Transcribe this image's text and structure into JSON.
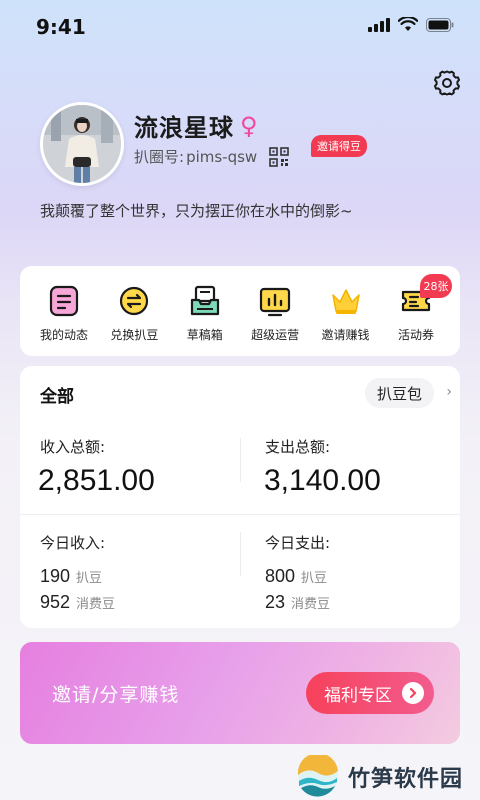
{
  "status": {
    "time": "9:41"
  },
  "profile": {
    "nickname": "流浪星球",
    "gender_symbol": "♀",
    "id_label": "扒圈号:",
    "id_value": "pims-qsw",
    "invite_badge": "邀请得豆",
    "bio": "我颠覆了整个世界，只为摆正你在水中的倒影~"
  },
  "shortcuts": [
    {
      "label": "我的动态",
      "icon": "my-posts-icon"
    },
    {
      "label": "兑换扒豆",
      "icon": "exchange-beans-icon"
    },
    {
      "label": "草稿箱",
      "icon": "drafts-icon"
    },
    {
      "label": "超级运营",
      "icon": "super-operation-icon"
    },
    {
      "label": "邀请赚钱",
      "icon": "crown-icon"
    },
    {
      "label": "活动券",
      "icon": "coupon-icon",
      "badge": "28张"
    }
  ],
  "stats": {
    "title": "全部",
    "beanbag_label": "扒豆包",
    "income_total_label": "收入总额:",
    "income_total_value": "2,851.00",
    "expense_total_label": "支出总额:",
    "expense_total_value": "3,140.00",
    "today_income_label": "今日收入:",
    "today_expense_label": "今日支出:",
    "today_income": [
      {
        "num": "190",
        "unit": "扒豆"
      },
      {
        "num": "952",
        "unit": "消费豆"
      }
    ],
    "today_expense": [
      {
        "num": "800",
        "unit": "扒豆"
      },
      {
        "num": "23",
        "unit": "消费豆"
      }
    ]
  },
  "promo": {
    "text": "邀请/分享赚钱",
    "button_label": "福利专区"
  },
  "watermark": {
    "text": "竹笋软件园"
  },
  "colors": {
    "accent": "#f23b52",
    "female": "#f0489d",
    "icon_yellow": "#ffd84a",
    "icon_outline": "#1a1a1a",
    "icon_pink": "#f7a6d8"
  }
}
